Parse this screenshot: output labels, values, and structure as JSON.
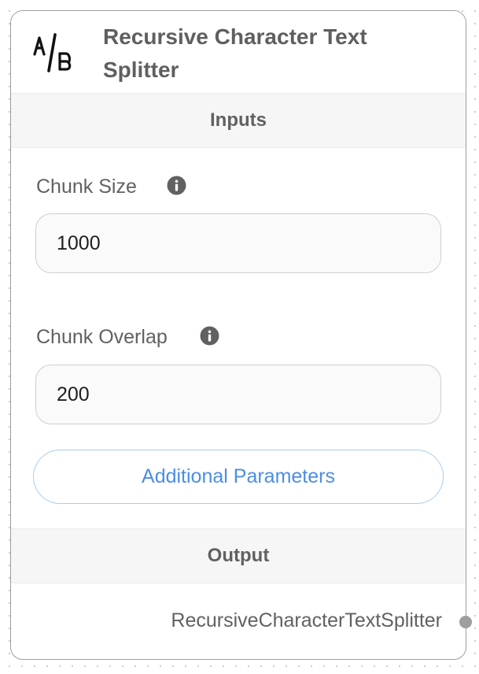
{
  "node": {
    "title": "Recursive Character Text Splitter",
    "icon": "ab-split-icon"
  },
  "inputs": {
    "header": "Inputs",
    "fields": [
      {
        "label": "Chunk Size",
        "value": "1000",
        "info_icon": "info-icon"
      },
      {
        "label": "Chunk Overlap",
        "value": "200",
        "info_icon": "info-icon"
      }
    ],
    "additional_button": "Additional Parameters"
  },
  "output": {
    "header": "Output",
    "label": "RecursiveCharacterTextSplitter"
  },
  "colors": {
    "button_text": "#4b8ee6",
    "button_border": "#a8cdf2",
    "section_bg": "#f6f6f6",
    "text": "#616161",
    "handle": "#9e9e9e"
  }
}
